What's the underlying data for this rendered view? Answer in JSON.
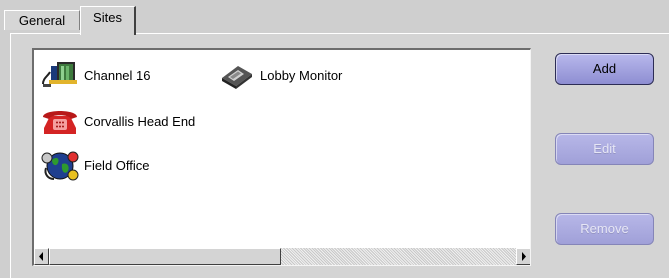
{
  "tabs": [
    {
      "label": "General",
      "selected": false
    },
    {
      "label": "Sites",
      "selected": true
    }
  ],
  "sites": [
    {
      "label": "Channel 16",
      "icon": "cable-device-icon"
    },
    {
      "label": "Lobby Monitor",
      "icon": "disk-drive-icon"
    },
    {
      "label": "Corvallis Head End",
      "icon": "telephone-icon"
    },
    {
      "label": "Field Office",
      "icon": "globe-network-icon"
    }
  ],
  "buttons": {
    "add": "Add",
    "edit": "Edit",
    "remove": "Remove"
  },
  "button_state": {
    "add": "enabled",
    "edit": "disabled",
    "remove": "disabled"
  },
  "colors": {
    "button": "#a8a8e0",
    "panel": "#d4d4d4",
    "list_bg": "#ffffff"
  }
}
